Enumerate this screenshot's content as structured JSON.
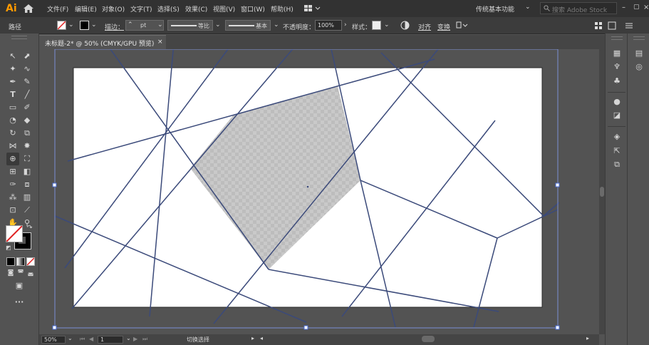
{
  "app": {
    "logo": "Ai"
  },
  "menu": [
    "文件(F)",
    "编辑(E)",
    "对象(O)",
    "文字(T)",
    "选择(S)",
    "效果(C)",
    "视图(V)",
    "窗口(W)",
    "帮助(H)"
  ],
  "workspace": {
    "label": "传统基本功能"
  },
  "search": {
    "placeholder": "搜索 Adobe Stock"
  },
  "control": {
    "selection_type": "路径",
    "stroke_label": "描边：",
    "stroke_value": "pt",
    "profile1": "等比",
    "profile2": "基本",
    "opacity_label": "不透明度：",
    "opacity_value": "100%",
    "style_label": "样式：",
    "align_label": "对齐",
    "transform_label": "变换"
  },
  "document": {
    "tab_title": "未标题-2* @ 50% (CMYK/GPU 预览)",
    "close": "×"
  },
  "status": {
    "zoom": "50%",
    "artboard": "1",
    "tool_hint": "切换选择"
  },
  "colors": {
    "accent": "#ff9a00",
    "path": "#3b4a7a",
    "artboard": "#ffffff",
    "fill": "#c8c8c8"
  }
}
